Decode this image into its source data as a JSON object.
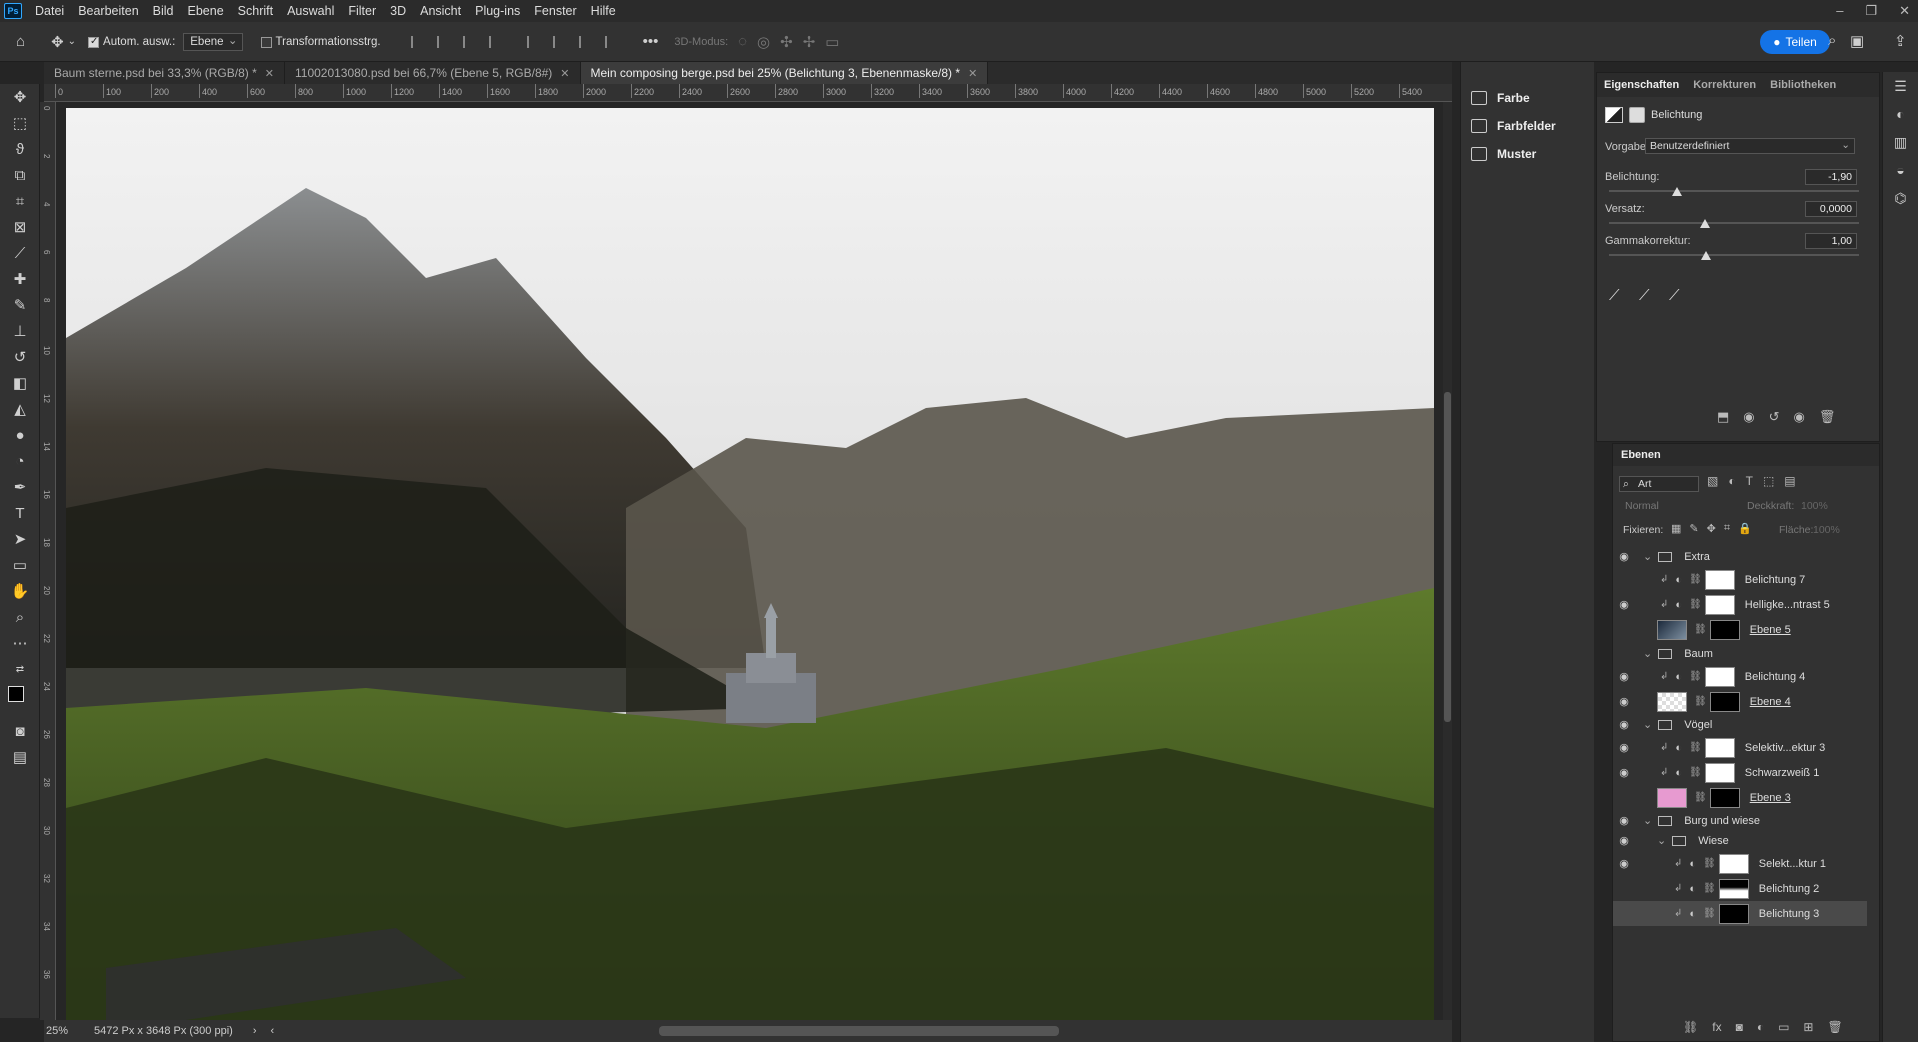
{
  "app": {
    "logo": "Ps"
  },
  "menu": [
    "Datei",
    "Bearbeiten",
    "Bild",
    "Ebene",
    "Schrift",
    "Auswahl",
    "Filter",
    "3D",
    "Ansicht",
    "Plug-ins",
    "Fenster",
    "Hilfe"
  ],
  "options": {
    "auto_select_label": "Autom. ausw.:",
    "auto_select_value": "Ebene",
    "transform_label": "Transformationsstrg.",
    "mode_3d_label": "3D-Modus:",
    "share_label": "Teilen"
  },
  "tabs": [
    {
      "label": "Baum sterne.psd bei 33,3% (RGB/8) *"
    },
    {
      "label": "11002013080.psd bei 66,7% (Ebene 5, RGB/8#)"
    },
    {
      "label": "Mein composing berge.psd bei 25% (Belichtung 3, Ebenenmaske/8) *"
    }
  ],
  "ruler_top": [
    "0",
    "100",
    "200",
    "400",
    "600",
    "800",
    "1000",
    "1200",
    "1400",
    "1600",
    "1800",
    "2000",
    "2200",
    "2400",
    "2600",
    "2800",
    "3000",
    "3200",
    "3400",
    "3600",
    "3800",
    "4000",
    "4200",
    "4400",
    "4600",
    "4800",
    "5000",
    "5200",
    "5400"
  ],
  "ruler_left": [
    "0",
    "2",
    "4",
    "6",
    "8",
    "10",
    "12",
    "14",
    "16",
    "18",
    "20",
    "22",
    "24",
    "26",
    "28",
    "30",
    "32",
    "34",
    "36"
  ],
  "status": {
    "zoom": "25%",
    "doc_info": "5472 Px x 3648 Px (300 ppi)"
  },
  "mini_panels": [
    {
      "label": "Farbe",
      "icon": "color-wheel-icon"
    },
    {
      "label": "Farbfelder",
      "icon": "swatches-grid-icon"
    },
    {
      "label": "Muster",
      "icon": "patterns-grid-icon"
    }
  ],
  "properties": {
    "tabs": [
      "Eigenschaften",
      "Korrekturen",
      "Bibliotheken"
    ],
    "adjustment_title": "Belichtung",
    "preset_label": "Vorgabe:",
    "preset_value": "Benutzerdefiniert",
    "exposure_label": "Belichtung:",
    "exposure_value": "-1,90",
    "offset_label": "Versatz:",
    "offset_value": "0,0000",
    "gamma_label": "Gammakorrektur:",
    "gamma_value": "1,00"
  },
  "layers_panel": {
    "title": "Ebenen",
    "filter_value": "Art",
    "blend_mode": "Normal",
    "opacity_label": "Deckkraft:",
    "opacity_value": "100%",
    "lock_label": "Fixieren:",
    "fill_label": "Fläche:",
    "fill_value": "100%",
    "rows": [
      {
        "name": "Extra",
        "type": "group",
        "indent": 0,
        "visible": true
      },
      {
        "name": "Belichtung 7",
        "type": "adjust",
        "indent": 1,
        "visible": false,
        "mask": "white"
      },
      {
        "name": "Helligke...ntrast 5",
        "type": "adjust",
        "indent": 1,
        "visible": true,
        "mask": "white"
      },
      {
        "name": "Ebene 5",
        "type": "pixel",
        "indent": 1,
        "visible": false,
        "thumb": "img",
        "mask": "black"
      },
      {
        "name": "Baum",
        "type": "group",
        "indent": 0,
        "visible": false
      },
      {
        "name": "Belichtung 4",
        "type": "adjust",
        "indent": 1,
        "visible": true,
        "mask": "white"
      },
      {
        "name": "Ebene 4",
        "type": "pixel",
        "indent": 1,
        "visible": true,
        "thumb": "checker",
        "mask": "black"
      },
      {
        "name": "Vögel",
        "type": "group",
        "indent": 0,
        "visible": true
      },
      {
        "name": "Selektiv...ektur 3",
        "type": "adjust",
        "indent": 1,
        "visible": true,
        "mask": "white"
      },
      {
        "name": "Schwarzweiß 1",
        "type": "adjust",
        "indent": 1,
        "visible": true,
        "mask": "white"
      },
      {
        "name": "Ebene 3",
        "type": "pixel",
        "indent": 1,
        "visible": false,
        "thumb": "pink",
        "mask": "black"
      },
      {
        "name": "Burg und wiese",
        "type": "group",
        "indent": 0,
        "visible": true
      },
      {
        "name": "Wiese",
        "type": "group",
        "indent": 1,
        "visible": true
      },
      {
        "name": "Selekt...ktur 1",
        "type": "adjust",
        "indent": 2,
        "visible": true,
        "mask": "white"
      },
      {
        "name": "Belichtung 2",
        "type": "adjust",
        "indent": 2,
        "visible": false,
        "mask": "maskhalf"
      },
      {
        "name": "Belichtung 3",
        "type": "adjust",
        "indent": 2,
        "visible": false,
        "mask": "black",
        "selected": true
      }
    ]
  }
}
